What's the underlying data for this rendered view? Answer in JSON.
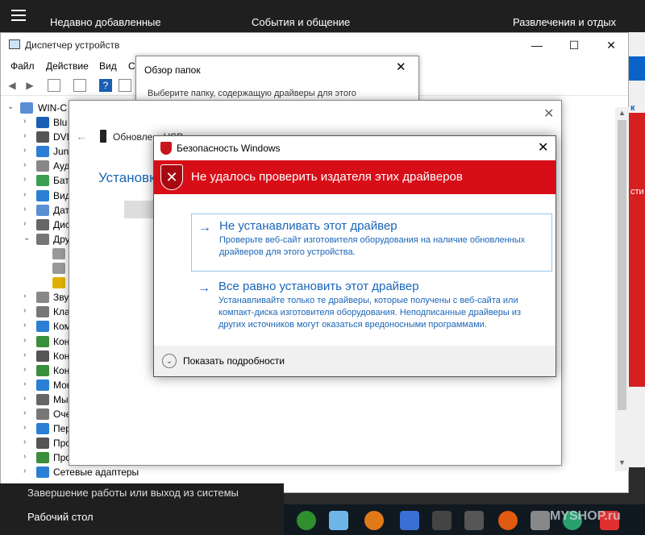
{
  "start_menu": {
    "col1": "Недавно добавленные",
    "col2": "События и общение",
    "col3": "Развлечения и отдых",
    "shutdown": "Завершение работы или выход из системы",
    "desktop": "Рабочий стол"
  },
  "device_manager": {
    "title": "Диспетчер устройств",
    "menu": [
      "Файл",
      "Действие",
      "Вид",
      "С"
    ],
    "tree_root": "WIN-C",
    "tree": [
      {
        "label": "Blu",
        "color": "#1a5fb4",
        "expanded": false
      },
      {
        "label": "DVD",
        "color": "#555555",
        "expanded": false
      },
      {
        "label": "Jun",
        "color": "#2a7fd4",
        "expanded": false
      },
      {
        "label": "Ауд",
        "color": "#888888",
        "expanded": false
      },
      {
        "label": "Бат",
        "color": "#3aa050",
        "expanded": false
      },
      {
        "label": "Вид",
        "color": "#2a7fd4",
        "expanded": false
      },
      {
        "label": "Дат",
        "color": "#5a8fd4",
        "expanded": false
      },
      {
        "label": "Дис",
        "color": "#666666",
        "expanded": false
      },
      {
        "label": "Дру",
        "color": "#777777",
        "expanded": true
      },
      {
        "label": "",
        "color": "#999999",
        "expanded": null
      },
      {
        "label": "",
        "color": "#999999",
        "expanded": null
      },
      {
        "label": "",
        "color": "#e0b000",
        "expanded": null
      },
      {
        "label": "Зву",
        "color": "#888888",
        "expanded": false
      },
      {
        "label": "Кла",
        "color": "#777777",
        "expanded": false
      },
      {
        "label": "Ком",
        "color": "#2a7fd4",
        "expanded": false
      },
      {
        "label": "Кон",
        "color": "#3a8f3a",
        "expanded": false
      },
      {
        "label": "Кон",
        "color": "#555555",
        "expanded": false
      },
      {
        "label": "Кон",
        "color": "#3a8f3a",
        "expanded": false
      },
      {
        "label": "Мон",
        "color": "#2a7fd4",
        "expanded": false
      },
      {
        "label": "Мы",
        "color": "#666666",
        "expanded": false
      },
      {
        "label": "Оче",
        "color": "#777777",
        "expanded": false
      },
      {
        "label": "Пер",
        "color": "#2a7fd4",
        "expanded": false
      },
      {
        "label": "Про",
        "color": "#555555",
        "expanded": false
      },
      {
        "label": "Про",
        "color": "#3a8f3a",
        "expanded": false
      },
      {
        "label": "Сетевые адаптеры",
        "color": "#2a7fd4",
        "expanded": false
      }
    ]
  },
  "browse_dialog": {
    "title": "Обзор папок",
    "subtitle": "Выберите папку, содержащую драйверы для этого"
  },
  "wizard": {
    "device": "Обновле... USB",
    "heading": "Установка"
  },
  "security_dialog": {
    "title": "Безопасность Windows",
    "banner": "Не удалось проверить издателя этих драйверов",
    "option1_title": "Не устанавливать этот драйвер",
    "option1_desc": "Проверьте веб-сайт изготовителя оборудования на наличие обновленных драйверов для этого устройства.",
    "option2_title": "Все равно установить этот драйвер",
    "option2_desc": "Устанавливайте только те драйверы, которые получены с веб-сайта или компакт-диска изготовителя оборудования. Неподписанные драйверы из других источников могут оказаться вредоносными программами.",
    "details": "Показать подробности"
  },
  "right_strip": {
    "text1": "к ТВ",
    "text2": "сти"
  },
  "taskbar_watermark": "MYSHOP.ru"
}
